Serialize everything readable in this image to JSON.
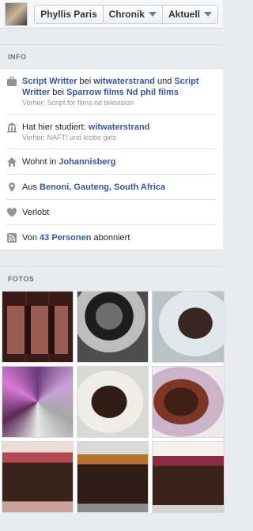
{
  "header": {
    "name_button": "Phyllis Paris",
    "timeline_button": "Chronik",
    "update_button": "Aktuell"
  },
  "info": {
    "section_title": "INFO",
    "work": {
      "role": "Script Writter",
      "bei1": " bei ",
      "employer1": "witwaterstrand",
      "und": " und ",
      "role2": "Script Writter",
      "bei2": " bei ",
      "employer2": "Sparrow films Nd phil films",
      "previous": "Vorher: Script for films nd television"
    },
    "education": {
      "prefix": "Hat hier studiert: ",
      "school": "witwaterstrand",
      "previous": "Vorher: NAFTI und krobo girls"
    },
    "lives": {
      "prefix": "Wohnt in ",
      "city": "Johannisberg"
    },
    "from": {
      "prefix": "Aus ",
      "place": "Benoni, Gauteng, South Africa"
    },
    "relationship": {
      "status": "Verlobt"
    },
    "followers": {
      "prefix": "Von ",
      "count": "43 Personen",
      "suffix": " abonniert"
    }
  },
  "photos": {
    "section_title": "FOTOS",
    "items": [
      "photo-1",
      "photo-2",
      "photo-3",
      "photo-4",
      "photo-5",
      "photo-6",
      "photo-7",
      "photo-8",
      "photo-9"
    ]
  },
  "icons": {
    "work": "briefcase-icon",
    "education": "school-icon",
    "home": "home-icon",
    "location": "location-pin-icon",
    "relationship": "heart-icon",
    "followers": "rss-icon"
  }
}
